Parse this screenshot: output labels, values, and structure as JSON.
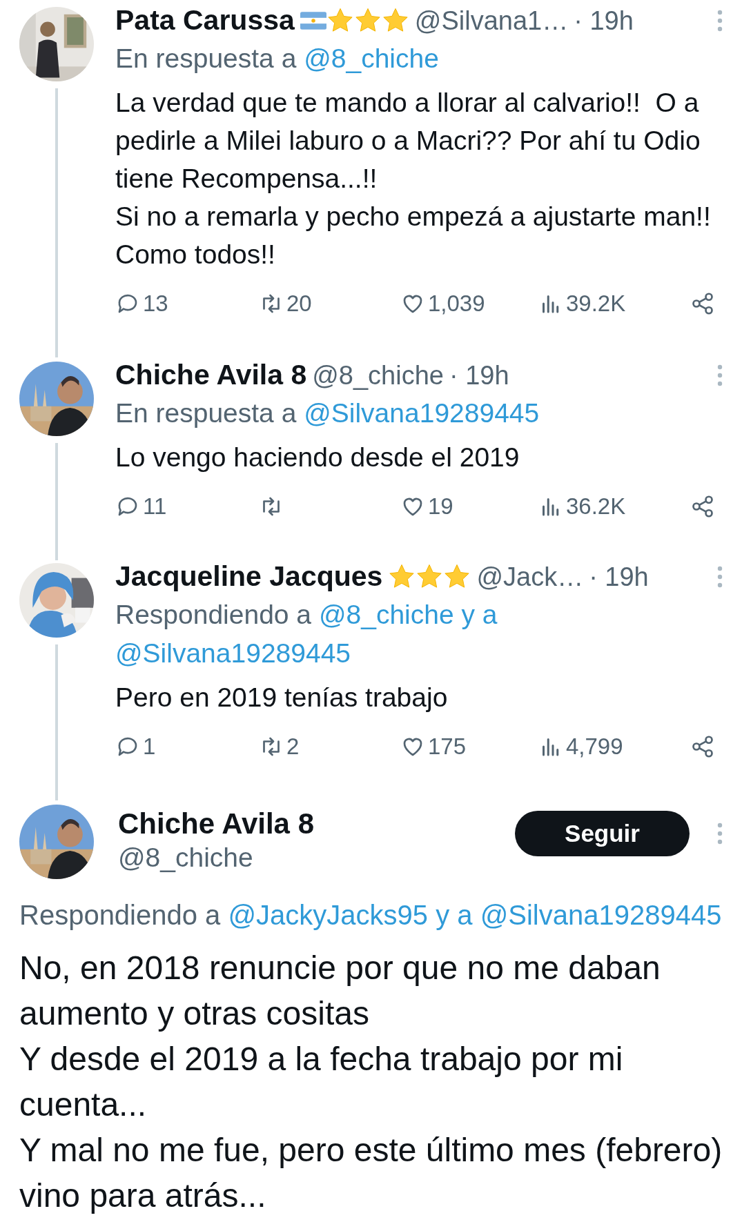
{
  "replies": [
    {
      "name": "Pata Carussa",
      "badges": [
        {
          "kind": "flag"
        },
        {
          "kind": "star"
        },
        {
          "kind": "star"
        },
        {
          "kind": "star"
        }
      ],
      "handle": "@Silvana1…",
      "time": "· 19h",
      "reply_to": [
        {
          "kind": "text",
          "text": "En respuesta a"
        },
        {
          "kind": "mention",
          "text": "@8_chiche"
        }
      ],
      "body": "La verdad que te mando a llorar al calvario!!  O a pedirle a Milei laburo o a Macri?? Por ahí tu Odio tiene Recompensa...!!\nSi no a remarla y pecho empezá a ajustarte man!! Como todos!!",
      "actions": {
        "replies": "13",
        "reposts": "20",
        "likes": "1,039",
        "views": "39.2K"
      }
    },
    {
      "name": "Chiche Avila 8",
      "handle": "@8_chiche",
      "time": "· 19h",
      "reply_to": [
        {
          "kind": "text",
          "text": "En respuesta a"
        },
        {
          "kind": "mention",
          "text": "@Silvana19289445"
        }
      ],
      "body": "Lo vengo haciendo desde el 2019",
      "actions": {
        "replies": "11",
        "likes": "19",
        "views": "36.2K"
      }
    },
    {
      "name": "Jacqueline Jacques",
      "badges": [
        {
          "kind": "star"
        },
        {
          "kind": "star"
        },
        {
          "kind": "star"
        }
      ],
      "handle": "@Jack…",
      "time": "· 19h",
      "reply_to": [
        {
          "kind": "text",
          "text": "Respondiendo a"
        },
        {
          "kind": "mention",
          "text": "@8_chiche"
        },
        {
          "kind": "joiner",
          "text": "y a"
        },
        {
          "kind": "mention",
          "text": "@Silvana19289445"
        }
      ],
      "body": "Pero en 2019 tenías trabajo",
      "actions": {
        "replies": "1",
        "reposts": "2",
        "likes": "175",
        "views": "4,799"
      }
    }
  ],
  "main_post": {
    "name": "Chiche Avila 8",
    "handle": "@8_chiche",
    "follow_button": "Seguir",
    "reply_to": [
      {
        "kind": "text",
        "text": "Respondiendo a"
      },
      {
        "kind": "mention",
        "text": "@JackyJacks95"
      },
      {
        "kind": "joiner",
        "text": "y a"
      },
      {
        "kind": "mention",
        "text": "@Silvana19289445"
      }
    ],
    "body": "No, en 2018 renuncie por que no me daban aumento y otras cositas\nY desde el 2019 a la fecha trabajo por mi cuenta...\nY mal no me fue, pero este último mes (febrero) vino para atrás..."
  }
}
